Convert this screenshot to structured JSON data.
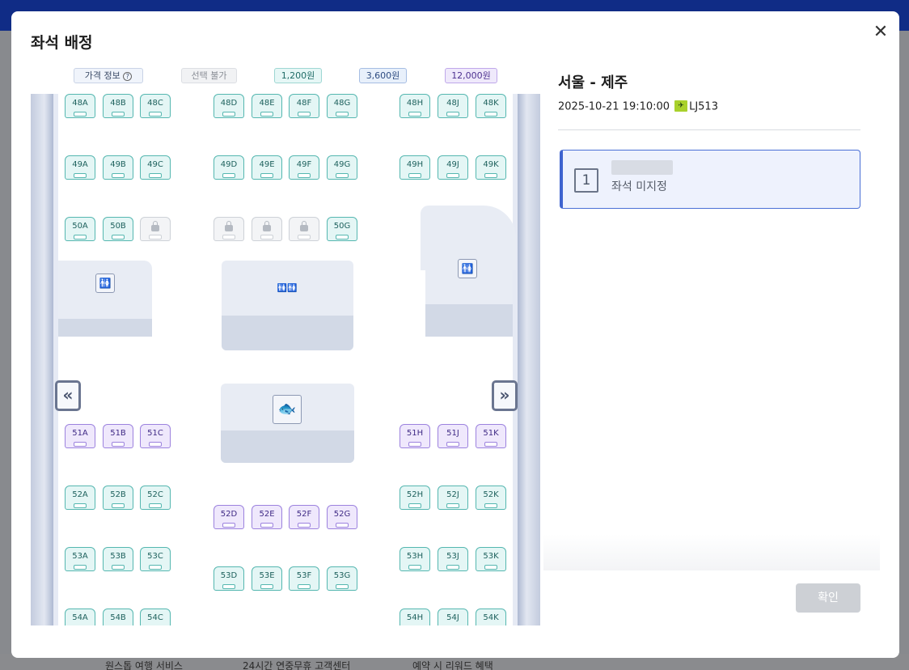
{
  "background": {
    "footer_items": [
      "원스톱 여행 서비스",
      "24시간 연중무휴 고객센터",
      "예약 시 리워드 혜택"
    ]
  },
  "modal": {
    "title": "좌석 배정",
    "close_icon": "close-icon"
  },
  "legend": {
    "info_label": "가격 정보",
    "info_icon": "help-circle-icon",
    "unavailable": "선택 불가",
    "price_1": "1,200원",
    "price_2": "3,600원",
    "price_3": "12,000원"
  },
  "seat_map": {
    "rows": {
      "r48": {
        "A": "48A",
        "B": "48B",
        "C": "48C",
        "D": "48D",
        "E": "48E",
        "F": "48F",
        "G": "48G",
        "H": "48H",
        "J": "48J",
        "K": "48K"
      },
      "r49": {
        "A": "49A",
        "B": "49B",
        "C": "49C",
        "D": "49D",
        "E": "49E",
        "F": "49F",
        "G": "49G",
        "H": "49H",
        "J": "49J",
        "K": "49K"
      },
      "r50": {
        "A": "50A",
        "B": "50B",
        "G": "50G"
      },
      "r51": {
        "A": "51A",
        "B": "51B",
        "C": "51C",
        "H": "51H",
        "J": "51J",
        "K": "51K"
      },
      "r52": {
        "A": "52A",
        "B": "52B",
        "C": "52C",
        "D": "52D",
        "E": "52E",
        "F": "52F",
        "G": "52G",
        "H": "52H",
        "J": "52J",
        "K": "52K"
      },
      "r53": {
        "A": "53A",
        "B": "53B",
        "C": "53C",
        "D": "53D",
        "E": "53E",
        "F": "53F",
        "G": "53G",
        "H": "53H",
        "J": "53J",
        "K": "53K"
      },
      "r54": {
        "A": "54A",
        "B": "54B",
        "C": "54C",
        "H": "54H",
        "J": "54J",
        "K": "54K"
      }
    },
    "prev_glyph": "«",
    "next_glyph": "»",
    "icons": [
      "lock-icon",
      "lavatory-icon",
      "galley-icon",
      "chevron-double-left-icon",
      "chevron-double-right-icon"
    ]
  },
  "flight": {
    "route": "서울 - 제주",
    "datetime": "2025-10-21 19:10:00",
    "airline_logo_icon": "jinair-logo-icon",
    "flight_no": "LJ513"
  },
  "passenger": {
    "number": "1",
    "status": "좌석 미지정"
  },
  "actions": {
    "confirm": "확인"
  },
  "colors": {
    "price_1200": "#55b7b0",
    "price_3600": "#6f8fd6",
    "price_12000": "#9c82de",
    "unavailable": "#cdd1d7",
    "selected_passenger": "#3e63cf",
    "top_bar": "#102c86"
  }
}
